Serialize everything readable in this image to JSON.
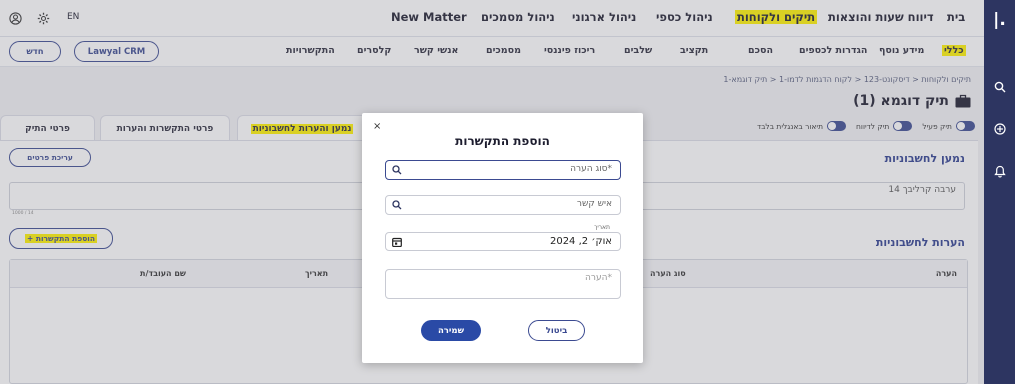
{
  "rail": {
    "logo": "|.",
    "icons": [
      "search-icon",
      "plus-circle-icon",
      "bell-icon"
    ]
  },
  "topbar": {
    "user_icon": "user-circle-icon",
    "settings_icon": "gear-icon",
    "lang": "EN",
    "new_matter": "New Matter",
    "nav": [
      "בית",
      "תיקים ולקוחות",
      "דיווח שעות והוצאות",
      "ניהול כספי",
      "ניהול ארגוני",
      "ניהול מסמכים"
    ],
    "highlight_color": "#fff300"
  },
  "subbar": {
    "new_btn": "חדש",
    "crm_btn": "Lawyal CRM",
    "items": [
      "כללי",
      "מידע נוסף",
      "הגדרות לכספים",
      "הסכם",
      "תקציב",
      "שלבים",
      "ריכוז פיננסי",
      "מסמכים",
      "אנשי קשר",
      "קלסרים",
      "התקשרויות"
    ]
  },
  "breadcrumb": "תיקים ולקוחות < דיסקונט-123 < לקוח הדגמות לדמו-1 < תיק דוגמא-1",
  "page": {
    "title": "תיק דוגמא (1)",
    "toggles": [
      "תיק פעיל",
      "תיק לדיווח",
      "תיאור באנגלית בלבד"
    ]
  },
  "tabs": [
    "פרטי התיק",
    "פרטי התקשרות והערות",
    "נמען והערות לחשבוניות"
  ],
  "panel": {
    "recipient_title": "נמען לחשבוניות",
    "edit_btn": "עריכת פרטים",
    "address": "ערבה קרליבך 14",
    "counter": "1000 / 14",
    "add_btn": "+ הוספת התקשרות",
    "notes_title": "הערות לחשבוניות",
    "columns": [
      "הערה",
      "סוג הערה",
      "תאריך",
      "שם העובד/ת"
    ]
  },
  "dialog": {
    "close": "×",
    "title": "הוספת התקשרות",
    "type_placeholder": "סוג הערה*",
    "contact_placeholder": "איש קשר",
    "date_label": "תאריך",
    "date_value": "אוק׳ 2, 2024",
    "note_placeholder": "הערה*",
    "save": "שמירה",
    "cancel": "ביטול"
  }
}
